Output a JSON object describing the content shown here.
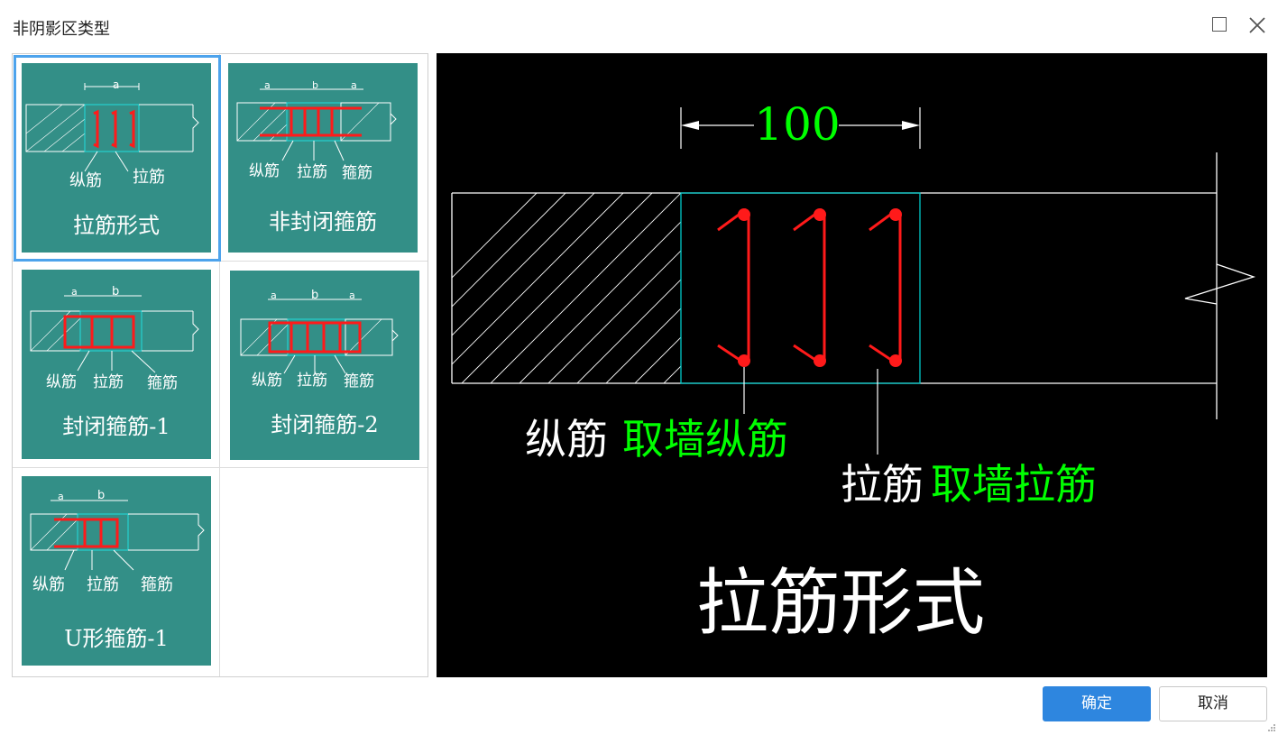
{
  "dialog": {
    "title": "非阴影区类型"
  },
  "window_controls": {
    "maximize_icon": "maximize-icon",
    "close_icon": "close-icon"
  },
  "options": [
    {
      "caption": "拉筋形式",
      "selected": true,
      "dims": [
        "a"
      ],
      "labels": [
        "纵筋",
        "拉筋"
      ]
    },
    {
      "caption": "非封闭箍筋",
      "selected": false,
      "dims": [
        "a",
        "b",
        "a"
      ],
      "labels": [
        "纵筋",
        "拉筋",
        "箍筋"
      ]
    },
    {
      "caption": "封闭箍筋-1",
      "selected": false,
      "dims": [
        "a",
        "b"
      ],
      "labels": [
        "纵筋",
        "拉筋",
        "箍筋"
      ]
    },
    {
      "caption": "封闭箍筋-2",
      "selected": false,
      "dims": [
        "a",
        "b",
        "a"
      ],
      "labels": [
        "纵筋",
        "拉筋",
        "箍筋"
      ]
    },
    {
      "caption": "U形箍筋-1",
      "selected": false,
      "dims": [
        "a",
        "b"
      ],
      "labels": [
        "纵筋",
        "拉筋",
        "箍筋"
      ]
    }
  ],
  "preview": {
    "dimension": "100",
    "longitudinal_label": "纵筋",
    "longitudinal_value": "取墙纵筋",
    "tie_label": "拉筋",
    "tie_value": "取墙拉筋",
    "title": "拉筋形式",
    "colors": {
      "background": "#000000",
      "dim_text": "#00ff00",
      "rebar": "#ff1a1a",
      "outline": "#00c8c8",
      "label": "#ffffff"
    }
  },
  "footer": {
    "ok_label": "确定",
    "cancel_label": "取消"
  }
}
